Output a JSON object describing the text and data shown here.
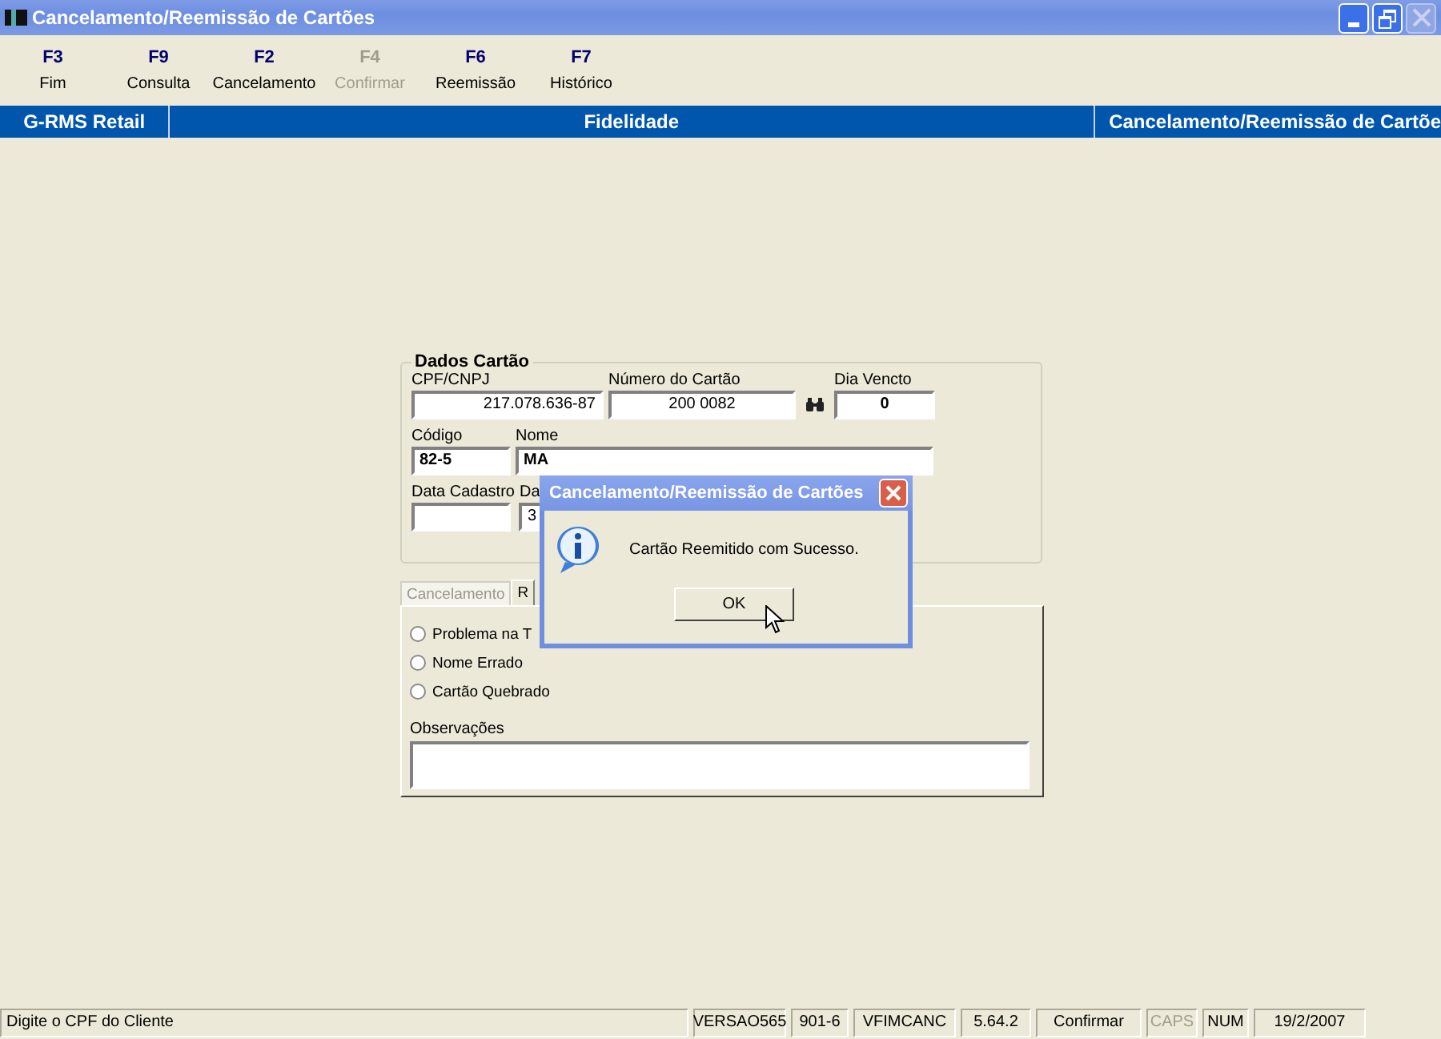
{
  "window": {
    "title": "Cancelamento/Reemissão de Cartões"
  },
  "toolbar": [
    {
      "key": "F3",
      "label": "Fim",
      "disabled": false
    },
    {
      "key": "F9",
      "label": "Consulta",
      "disabled": false
    },
    {
      "key": "F2",
      "label": "Cancelamento",
      "disabled": false
    },
    {
      "key": "F4",
      "label": "Confirmar",
      "disabled": true
    },
    {
      "key": "F6",
      "label": "Reemissão",
      "disabled": false
    },
    {
      "key": "F7",
      "label": "Histórico",
      "disabled": false
    }
  ],
  "header_bar": [
    "G-RMS Retail",
    "Fidelidade",
    "Cancelamento/Reemissão de Cartõe"
  ],
  "card_data": {
    "title": "Dados Cartão",
    "rows": [
      [
        {
          "label": "CPF/CNPJ",
          "value": "217.078.636-87"
        },
        {
          "label": "Número do Cartão",
          "value": "200 0082"
        },
        {
          "label": "Dia Vencto",
          "value": "0"
        }
      ],
      [
        {
          "label": "Código",
          "value": "82-5"
        },
        {
          "label": "Nome",
          "value": "MA"
        }
      ],
      [
        {
          "label": "Data Cadastro"
        },
        {
          "label": "Da",
          "value": "3"
        }
      ]
    ]
  },
  "tabs": [
    {
      "label": "Cancelamento",
      "selected": false
    },
    {
      "label": "R",
      "selected": true
    }
  ],
  "reasons": [
    {
      "label": "Problema na T",
      "checked": false
    },
    {
      "label": "Nome Errado",
      "checked": false
    },
    {
      "label": "Cartão Quebrado",
      "checked": false
    }
  ],
  "observations": {
    "label": "Observações"
  },
  "dialog": {
    "title": "Cancelamento/Reemissão de Cartões",
    "message": "Cartão Reemitido com Sucesso.",
    "button": "OK"
  },
  "status_bar": [
    {
      "text": "Digite o CPF do Cliente",
      "disabled": false
    },
    {
      "text": "VERSAO565",
      "disabled": false
    },
    {
      "text": "901-6",
      "disabled": false
    },
    {
      "text": "VFIMCANC",
      "disabled": false
    },
    {
      "text": "5.64.2",
      "disabled": false
    },
    {
      "text": "Confirmar",
      "disabled": false
    },
    {
      "text": "CAPS",
      "disabled": true
    },
    {
      "text": "NUM",
      "disabled": false
    },
    {
      "text": "19/2/2007",
      "disabled": false
    }
  ]
}
